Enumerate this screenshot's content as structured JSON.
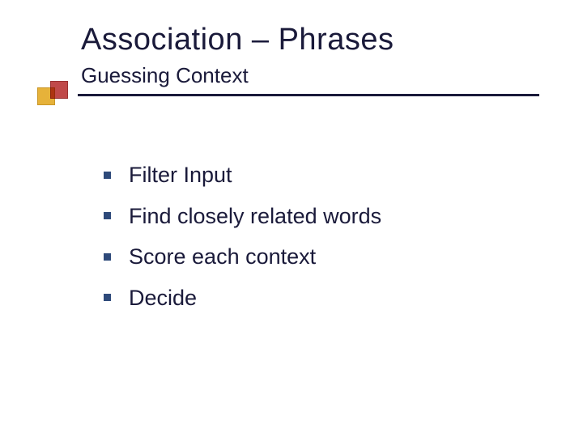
{
  "title": "Association – Phrases",
  "subtitle": "Guessing Context",
  "bullets": [
    "Filter Input",
    "Find closely related words",
    "Score each context",
    "Decide"
  ]
}
